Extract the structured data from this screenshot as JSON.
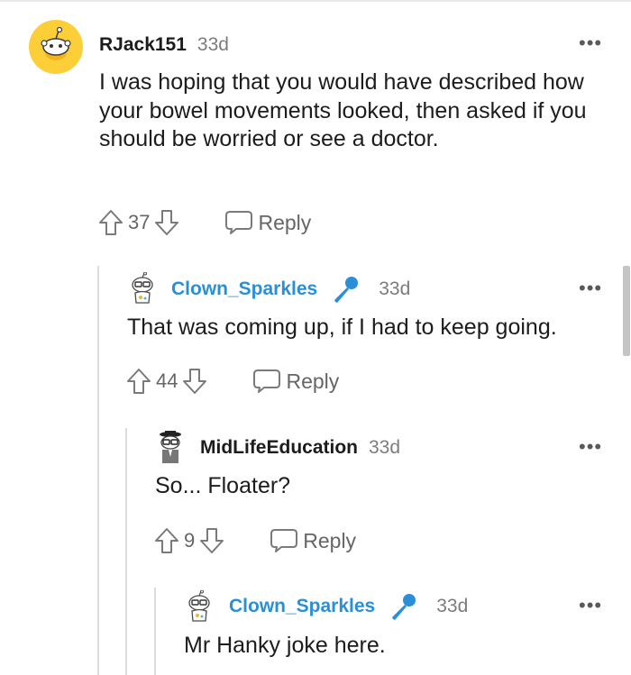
{
  "comments": [
    {
      "username": "RJack151",
      "time": "33d",
      "text": "I was hoping that you would have described how your bowel movements looked, then asked if you should be worried or see a doctor.",
      "score": "37",
      "reply_label": "Reply",
      "is_op": false
    },
    {
      "username": "Clown_Sparkles",
      "time": "33d",
      "text": "That was coming up, if I had to keep going.",
      "score": "44",
      "reply_label": "Reply",
      "is_op": true
    },
    {
      "username": "MidLifeEducation",
      "time": "33d",
      "text": "So... Floater?",
      "score": "9",
      "reply_label": "Reply",
      "is_op": false
    },
    {
      "username": "Clown_Sparkles",
      "time": "33d",
      "text": "Mr Hanky joke here.",
      "is_op": true
    }
  ],
  "colors": {
    "op_username": "#2a8fd6",
    "mic_icon": "#2a8fd6",
    "thread_line": "#dcdcdc",
    "meta_text": "#7c7c7c"
  },
  "icons": {
    "upvote": "arrow-up-icon",
    "downvote": "arrow-down-icon",
    "reply": "speech-bubble-icon",
    "more": "more-options-icon",
    "op_badge": "microphone-icon"
  }
}
